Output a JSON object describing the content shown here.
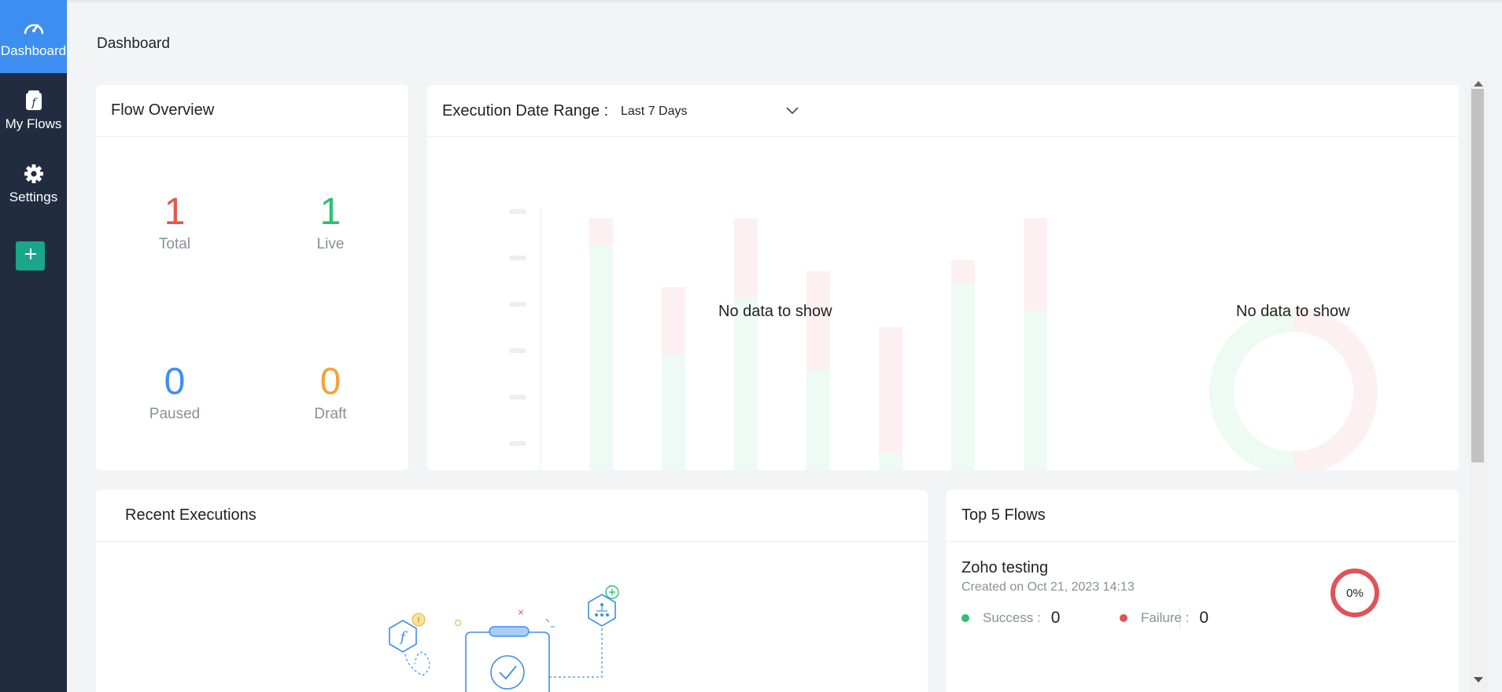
{
  "sidebar": {
    "items": [
      {
        "label": "Dashboard",
        "icon": "speedometer-icon",
        "active": true
      },
      {
        "label": "My Flows",
        "icon": "flow-script-icon",
        "active": false
      },
      {
        "label": "Settings",
        "icon": "gear-icon",
        "active": false
      }
    ],
    "add_icon": "plus-icon"
  },
  "page_title": "Dashboard",
  "flow_overview": {
    "title": "Flow Overview",
    "stats": [
      {
        "label": "Total",
        "value": "1",
        "color": "#e05a4b"
      },
      {
        "label": "Live",
        "value": "1",
        "color": "#2fbf71"
      },
      {
        "label": "Paused",
        "value": "0",
        "color": "#3d8ef0"
      },
      {
        "label": "Draft",
        "value": "0",
        "color": "#f5a23a"
      }
    ]
  },
  "execution": {
    "label": "Execution Date Range :",
    "range_selected": "Last 7 Days",
    "bar_chart_empty_text": "No data to show",
    "donut_empty_text": "No data to show"
  },
  "recent_executions": {
    "title": "Recent Executions"
  },
  "top_flows": {
    "title": "Top 5 Flows",
    "items": [
      {
        "name": "Zoho testing",
        "created": "Created on Oct 21, 2023 14:13",
        "success_label": "Success :",
        "success_value": "0",
        "failure_label": "Failure :",
        "failure_value": "0",
        "percent": "0%"
      }
    ]
  },
  "colors": {
    "sidebar_bg": "#222c41",
    "active_nav": "#3d8ef0",
    "add_button": "#19a68a",
    "success": "#2fbf71",
    "failure": "#e05358"
  }
}
